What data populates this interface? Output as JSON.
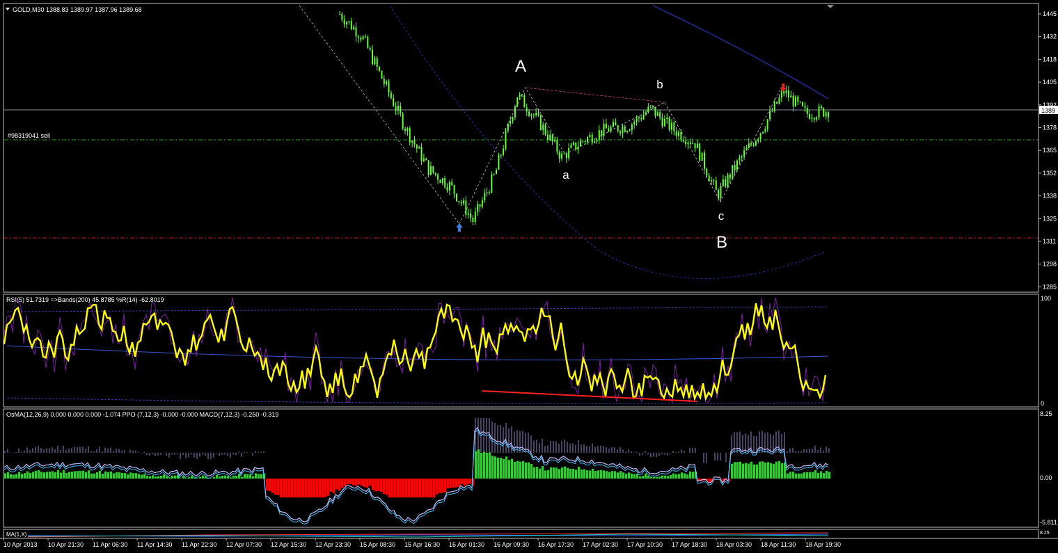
{
  "main_header": "GOLD,M30  1388.83 1389.97 1387.96 1389.68",
  "order_label": "#98319041 sell",
  "price_axis": [
    "1445",
    "1432",
    "1418",
    "1405",
    "1392",
    "1378",
    "1365",
    "1352",
    "1338",
    "1325",
    "1311",
    "1298",
    "1285"
  ],
  "current_price_label": "1389",
  "wave_labels": {
    "A": "A",
    "a": "a",
    "b": "b",
    "c": "c",
    "B": "B"
  },
  "rsi_header": "RSI(5) 51.7319  =>Bands(200) 45.8785  %R(14) -62.8019",
  "rsi_axis": [
    "100",
    "0"
  ],
  "macd_header": "OsMA(12,26,9) 0.000 0.000 0.000 -1.074  PPO (7,12,3) -0.000 -0.000  MACD(7,12,3) -0.250 -0.319",
  "macd_axis": [
    "8.25",
    "0.00",
    "-5.811"
  ],
  "bottom_header": "MA(1,X)",
  "time_axis": [
    "10 Apr 2013",
    "10 Apr 21:30",
    "11 Apr 06:30",
    "11 Apr 14:30",
    "11 Apr 22:30",
    "12 Apr 07:30",
    "12 Apr 15:30",
    "12 Apr 23:30",
    "15 Apr 08:30",
    "15 Apr 16:30",
    "16 Apr 01:30",
    "16 Apr 09:30",
    "16 Apr 17:30",
    "17 Apr 02:30",
    "17 Apr 10:30",
    "17 Apr 18:30",
    "18 Apr 03:30",
    "18 Apr 11:30",
    "18 Apr 19:30"
  ],
  "colors": {
    "candle": "#66ff33",
    "rsi": "#ffff00",
    "wave_big": "#ff00ff",
    "wave_small": "#ff8c00",
    "hist_pos": "#32cd32",
    "hist_neg": "#ff0000"
  },
  "chart_data": {
    "type": "candlestick",
    "symbol": "GOLD",
    "timeframe": "M30",
    "close_path": [
      {
        "t": "15 Apr 00:00",
        "p": 1445
      },
      {
        "t": "15 Apr 04:00",
        "p": 1432
      },
      {
        "t": "15 Apr 08:30",
        "p": 1405
      },
      {
        "t": "15 Apr 12:30",
        "p": 1378
      },
      {
        "t": "15 Apr 16:30",
        "p": 1355
      },
      {
        "t": "15 Apr 20:30",
        "p": 1345
      },
      {
        "t": "16 Apr 01:30",
        "p": 1325
      },
      {
        "t": "16 Apr 05:30",
        "p": 1352
      },
      {
        "t": "16 Apr 09:30",
        "p": 1398
      },
      {
        "t": "16 Apr 13:30",
        "p": 1382
      },
      {
        "t": "16 Apr 17:30",
        "p": 1362
      },
      {
        "t": "16 Apr 22:00",
        "p": 1372
      },
      {
        "t": "17 Apr 02:30",
        "p": 1378
      },
      {
        "t": "17 Apr 06:30",
        "p": 1380
      },
      {
        "t": "17 Apr 10:30",
        "p": 1390
      },
      {
        "t": "17 Apr 14:30",
        "p": 1378
      },
      {
        "t": "17 Apr 18:30",
        "p": 1370
      },
      {
        "t": "17 Apr 23:00",
        "p": 1340
      },
      {
        "t": "18 Apr 03:30",
        "p": 1360
      },
      {
        "t": "18 Apr 07:30",
        "p": 1378
      },
      {
        "t": "18 Apr 11:30",
        "p": 1400
      },
      {
        "t": "18 Apr 15:30",
        "p": 1387
      },
      {
        "t": "18 Apr 19:30",
        "p": 1389
      }
    ],
    "levels": {
      "current": 1389.68,
      "sell_order": 1371,
      "stop": 1316
    },
    "ylim": [
      1285,
      1450
    ],
    "rsi_ylim": [
      0,
      100
    ],
    "macd_ylim": [
      -5.811,
      8.25
    ]
  }
}
